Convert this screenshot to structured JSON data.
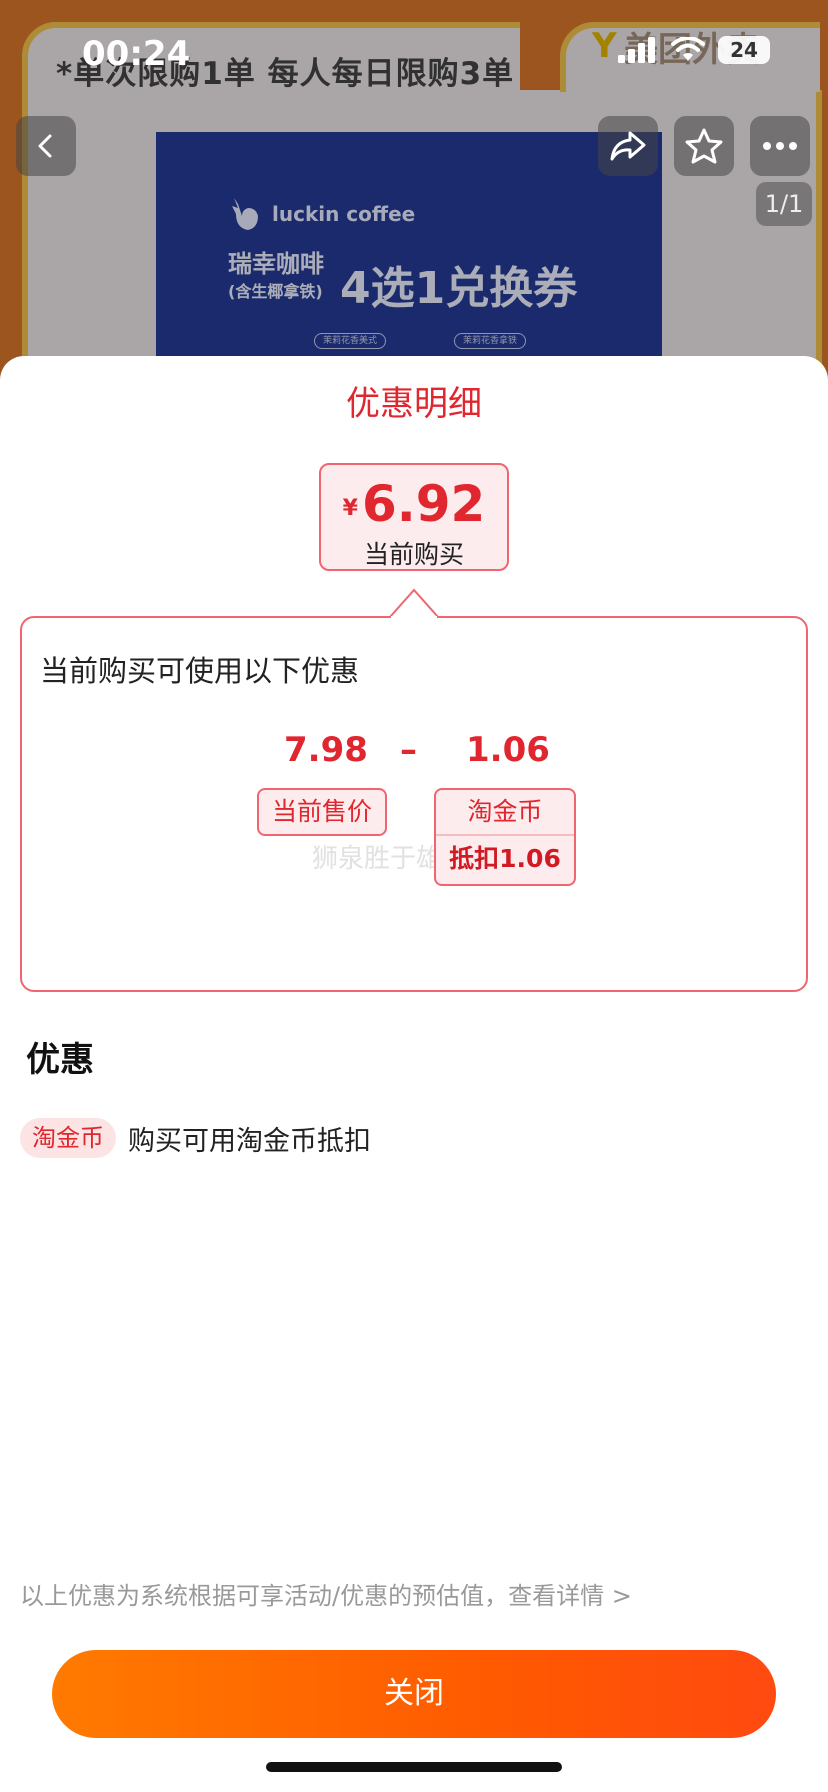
{
  "status_bar": {
    "time": "00:24",
    "battery": "24"
  },
  "background": {
    "limit_text": "*单次限购1单 每人每日限购3单",
    "brand": "美团外卖",
    "banner": {
      "logo_text": "luckin coffee",
      "title_small_1": "瑞幸咖啡",
      "title_small_2": "(含生椰拿铁)",
      "title_big": "4选1兑换券",
      "pill_left": "茉莉花香美式",
      "pill_right": "茉莉花香拿铁"
    },
    "page_indicator": "1/1"
  },
  "sheet": {
    "title": "优惠明细",
    "price": {
      "currency": "¥",
      "value": "6.92",
      "label": "当前购买"
    },
    "card": {
      "heading": "当前购买可使用以下优惠",
      "original_price": "7.98",
      "minus": "–",
      "deduction": "1.06",
      "price_tag": "当前售价",
      "coin_tag": "淘金币",
      "coin_deduct": "抵扣1.06",
      "watermark": "狮泉胜于雄辩"
    },
    "section_title": "优惠",
    "promo": {
      "badge": "淘金币",
      "text": "购买可用淘金币抵扣"
    },
    "footnote": "以上优惠为系统根据可享活动/优惠的预估值，查看详情 >",
    "close_label": "关闭"
  },
  "colors": {
    "accent_red": "#e0262e",
    "button_orange": "#ff6a00"
  }
}
